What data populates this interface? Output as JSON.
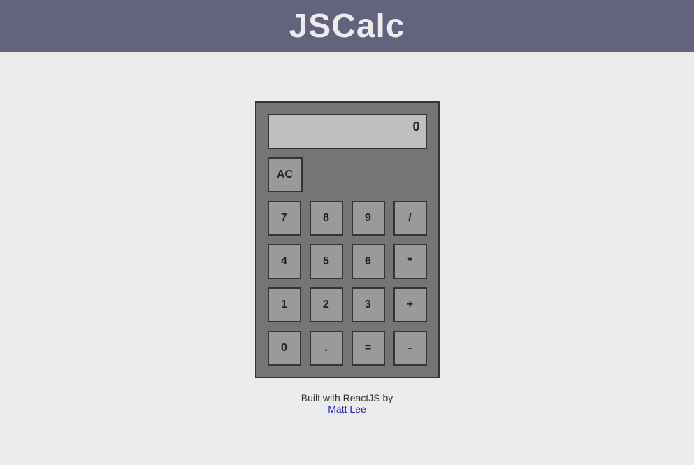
{
  "header": {
    "title": "JSCalc"
  },
  "calculator": {
    "display_value": "0",
    "buttons": {
      "ac": "AC",
      "seven": "7",
      "eight": "8",
      "nine": "9",
      "divide": "/",
      "four": "4",
      "five": "5",
      "six": "6",
      "multiply": "*",
      "one": "1",
      "two": "2",
      "three": "3",
      "plus": "+",
      "zero": "0",
      "decimal": ".",
      "equals": "=",
      "minus": "-"
    }
  },
  "footer": {
    "text": "Built with ReactJS by",
    "link_text": "Matt Lee"
  }
}
